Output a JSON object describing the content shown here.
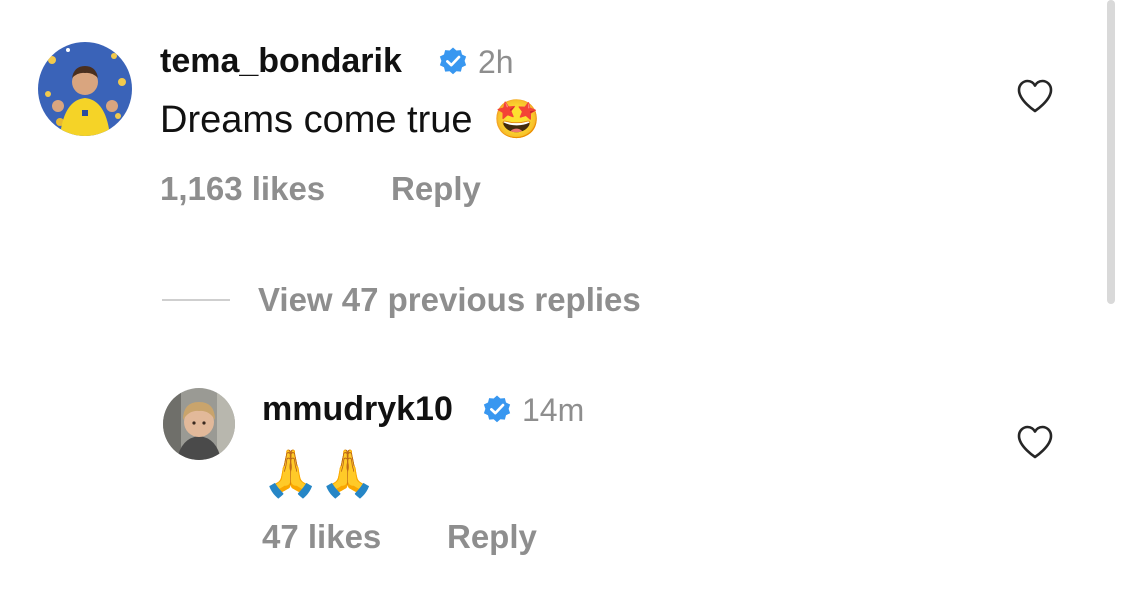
{
  "comments": [
    {
      "username": "tema_bondarik",
      "time": "2h",
      "text": "Dreams come true",
      "emoji": "🤩",
      "likes": "1,163 likes",
      "reply": "Reply",
      "avatar": "avatar-yellow-jersey"
    },
    {
      "username": "mmudryk10",
      "time": "14m",
      "text": "",
      "emoji": "🙏🙏",
      "likes": "47 likes",
      "reply": "Reply",
      "avatar": "avatar-boy-photo"
    }
  ],
  "view_replies": "View 47 previous replies",
  "icons": {
    "verified": "verified-badge-icon",
    "like": "heart-icon"
  },
  "colors": {
    "verified": "#3897f0",
    "secondary_text": "#8e8e8e"
  }
}
